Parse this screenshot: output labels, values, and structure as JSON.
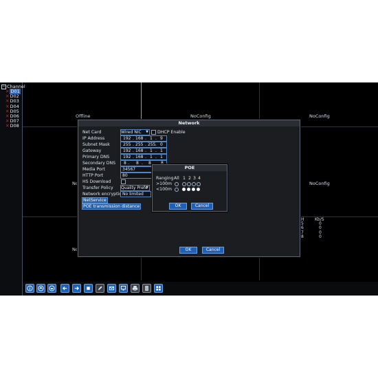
{
  "channel_panel": {
    "header": "Channel",
    "channels": [
      {
        "label": "D01",
        "selected": true
      },
      {
        "label": "D02",
        "selected": false
      },
      {
        "label": "D03",
        "selected": false
      },
      {
        "label": "D04",
        "selected": false
      },
      {
        "label": "D05",
        "selected": false
      },
      {
        "label": "D06",
        "selected": false
      },
      {
        "label": "D07",
        "selected": false
      },
      {
        "label": "D08",
        "selected": false
      }
    ]
  },
  "video_grid": {
    "cell_1": "Offline",
    "cell_2": "NoConfig",
    "cell_3": "NoConfig",
    "cell_4": "No",
    "cell_5": "NoConfig",
    "cell_7": "No"
  },
  "bitrate": {
    "col_channel": "H",
    "col_rate": "Kb/S",
    "rows": [
      {
        "ch": "5",
        "kbps": "0"
      },
      {
        "ch": "6",
        "kbps": "0"
      },
      {
        "ch": "7",
        "kbps": "0"
      },
      {
        "ch": "8",
        "kbps": "0"
      }
    ]
  },
  "network_dialog": {
    "title": "Network",
    "net_card_label": "Net Card",
    "net_card_value": "Wired NIC",
    "dhcp_label": "DHCP Enable",
    "ip_label": "IP Address",
    "ip": [
      "192",
      "168",
      "1",
      "9"
    ],
    "mask_label": "Subnet Mask",
    "mask": [
      "255",
      "255",
      "255",
      "0"
    ],
    "gateway_label": "Gateway",
    "gateway": [
      "192",
      "168",
      "1",
      "1"
    ],
    "dns1_label": "Primary DNS",
    "dns1": [
      "192",
      "168",
      "1",
      "1"
    ],
    "dns2_label": "Secondary DNS",
    "dns2": [
      "8",
      "8",
      "8",
      "8"
    ],
    "media_port_label": "Media Port",
    "media_port": "34567",
    "http_port_label": "HTTP Port",
    "http_port": "80",
    "hs_download_label": "HS Download",
    "transfer_policy_label": "Transfer Policy",
    "transfer_policy_value": "Quality Prefe",
    "encryption_label": "Network encryption",
    "encryption_value": "No limited",
    "netservice": "NetService",
    "poe_distance": "POE transmission distance",
    "ok": "OK",
    "cancel": "Cancel"
  },
  "poe_dialog": {
    "title": "POE",
    "ranging_label": "Ranging",
    "col_all": "All",
    "cols": [
      "1",
      "2",
      "3",
      "4"
    ],
    "row1_label": ">100m",
    "row2_label": "<100m",
    "ok": "OK",
    "cancel": "Cancel"
  },
  "toolbar": {
    "icons": [
      "info-icon",
      "upload-icon",
      "download-icon",
      "arrow-left-icon",
      "arrow-right-icon",
      "stop-icon",
      "edit-icon",
      "mail-icon",
      "monitor-icon",
      "print-icon",
      "file-icon",
      "grid-layout-icon"
    ]
  }
}
